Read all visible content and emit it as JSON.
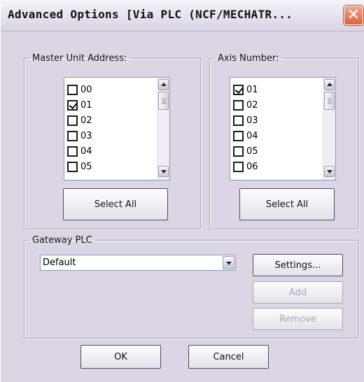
{
  "dialog": {
    "title": "Advanced Options [Via PLC (NCF/MECHATR...",
    "close_glyph": "✕"
  },
  "master": {
    "legend": "Master Unit Address:",
    "items": [
      {
        "label": "00",
        "checked": false
      },
      {
        "label": "01",
        "checked": true
      },
      {
        "label": "02",
        "checked": false
      },
      {
        "label": "03",
        "checked": false
      },
      {
        "label": "04",
        "checked": false
      },
      {
        "label": "05",
        "checked": false
      }
    ],
    "select_all_label": "Select All"
  },
  "axis": {
    "legend": "Axis Number:",
    "items": [
      {
        "label": "01",
        "checked": true
      },
      {
        "label": "02",
        "checked": false
      },
      {
        "label": "03",
        "checked": false
      },
      {
        "label": "04",
        "checked": false
      },
      {
        "label": "05",
        "checked": false
      },
      {
        "label": "06",
        "checked": false
      }
    ],
    "select_all_label": "Select All"
  },
  "gateway": {
    "legend": "Gateway PLC",
    "selected": "Default",
    "settings_label": "Settings...",
    "add_label": "Add",
    "remove_label": "Remove"
  },
  "footer": {
    "ok_label": "OK",
    "cancel_label": "Cancel"
  },
  "colors": {
    "dialog_bg": "#dcd6e4",
    "close_button": "#e0603a",
    "listbox_border": "#7f9db9",
    "disabled_text": "#a9a6b5"
  }
}
